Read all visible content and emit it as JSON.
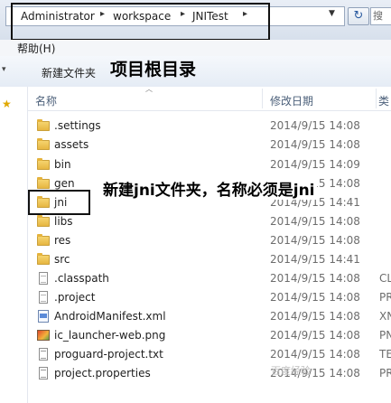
{
  "address_bar": {
    "crumbs": [
      "Administrator",
      "workspace",
      "JNITest"
    ],
    "separator": "▸",
    "dropdown_icon": "chevron-down-icon",
    "refresh_icon": "refresh-icon",
    "search_label": "搜"
  },
  "menu": {
    "help": "帮助(H)"
  },
  "toolbar": {
    "new_folder": "新建文件夹",
    "organize_arrow": "▾"
  },
  "annotations": {
    "root": "项目根目录",
    "jni": "新建jni文件夹，名称必须是jni"
  },
  "columns": {
    "name": "名称",
    "date": "修改日期",
    "type": "类"
  },
  "files": [
    {
      "name": ".settings",
      "date": "2014/9/15 14:08",
      "type": "",
      "icon": "folder-icon"
    },
    {
      "name": "assets",
      "date": "2014/9/15 14:08",
      "type": "",
      "icon": "folder-icon"
    },
    {
      "name": "bin",
      "date": "2014/9/15 14:09",
      "type": "",
      "icon": "folder-icon"
    },
    {
      "name": "gen",
      "date": "2014/9/15 14:08",
      "type": "",
      "icon": "folder-icon"
    },
    {
      "name": "jni",
      "date": "2014/9/15 14:41",
      "type": "",
      "icon": "folder-icon"
    },
    {
      "name": "libs",
      "date": "2014/9/15 14:08",
      "type": "",
      "icon": "folder-icon"
    },
    {
      "name": "res",
      "date": "2014/9/15 14:08",
      "type": "",
      "icon": "folder-icon"
    },
    {
      "name": "src",
      "date": "2014/9/15 14:41",
      "type": "",
      "icon": "folder-icon"
    },
    {
      "name": ".classpath",
      "date": "2014/9/15 14:08",
      "type": "CL",
      "icon": "document-icon"
    },
    {
      "name": ".project",
      "date": "2014/9/15 14:08",
      "type": "PR",
      "icon": "document-icon"
    },
    {
      "name": "AndroidManifest.xml",
      "date": "2014/9/15 14:08",
      "type": "XN",
      "icon": "xml-file-icon"
    },
    {
      "name": "ic_launcher-web.png",
      "date": "2014/9/15 14:08",
      "type": "PN",
      "icon": "image-file-icon"
    },
    {
      "name": "proguard-project.txt",
      "date": "2014/9/15 14:08",
      "type": "TE",
      "icon": "text-file-icon"
    },
    {
      "name": "project.properties",
      "date": "2014/9/15 14:08",
      "type": "PR",
      "icon": "text-file-icon"
    }
  ],
  "watermark": "百度经验"
}
